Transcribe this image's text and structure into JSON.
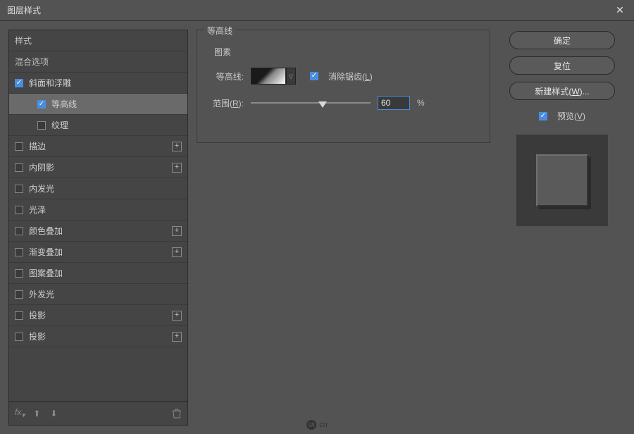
{
  "window": {
    "title": "图层样式",
    "close_aria": "关闭"
  },
  "sidebar": {
    "header_styles": "样式",
    "header_blend": "混合选项",
    "items": [
      {
        "label": "斜面和浮雕",
        "checked": true,
        "indent": 0,
        "plus": false,
        "selected": false
      },
      {
        "label": "等高线",
        "checked": true,
        "indent": 1,
        "plus": false,
        "selected": true
      },
      {
        "label": "纹理",
        "checked": false,
        "indent": 1,
        "plus": false,
        "selected": false
      },
      {
        "label": "描边",
        "checked": false,
        "indent": 0,
        "plus": true,
        "selected": false
      },
      {
        "label": "内阴影",
        "checked": false,
        "indent": 0,
        "plus": true,
        "selected": false
      },
      {
        "label": "内发光",
        "checked": false,
        "indent": 0,
        "plus": false,
        "selected": false
      },
      {
        "label": "光泽",
        "checked": false,
        "indent": 0,
        "plus": false,
        "selected": false
      },
      {
        "label": "颜色叠加",
        "checked": false,
        "indent": 0,
        "plus": true,
        "selected": false
      },
      {
        "label": "渐变叠加",
        "checked": false,
        "indent": 0,
        "plus": true,
        "selected": false
      },
      {
        "label": "图案叠加",
        "checked": false,
        "indent": 0,
        "plus": false,
        "selected": false
      },
      {
        "label": "外发光",
        "checked": false,
        "indent": 0,
        "plus": false,
        "selected": false
      },
      {
        "label": "投影",
        "checked": false,
        "indent": 0,
        "plus": true,
        "selected": false
      },
      {
        "label": "投影",
        "checked": false,
        "indent": 0,
        "plus": true,
        "selected": false
      }
    ],
    "footer_fx": "fx",
    "footer_up": "▲",
    "footer_down": "▼",
    "footer_trash": "🗑"
  },
  "center": {
    "group_title": "等高线",
    "subgroup_title": "图素",
    "contour_label": "等高线:",
    "antialias_pre": "消除锯齿(",
    "antialias_hot": "L",
    "antialias_post": ")",
    "antialias_checked": true,
    "range_label_pre": "范围(",
    "range_label_hot": "R",
    "range_label_post": "):",
    "range_value": "60",
    "range_unit": "%",
    "range_percent": 60
  },
  "right": {
    "ok": "确定",
    "reset": "复位",
    "new_style_pre": "新建样式(",
    "new_style_hot": "W",
    "new_style_post": ")...",
    "preview_pre": "预览(",
    "preview_hot": "V",
    "preview_post": ")",
    "preview_checked": true
  },
  "watermark": {
    "badge": "UI",
    "text": "cn"
  }
}
